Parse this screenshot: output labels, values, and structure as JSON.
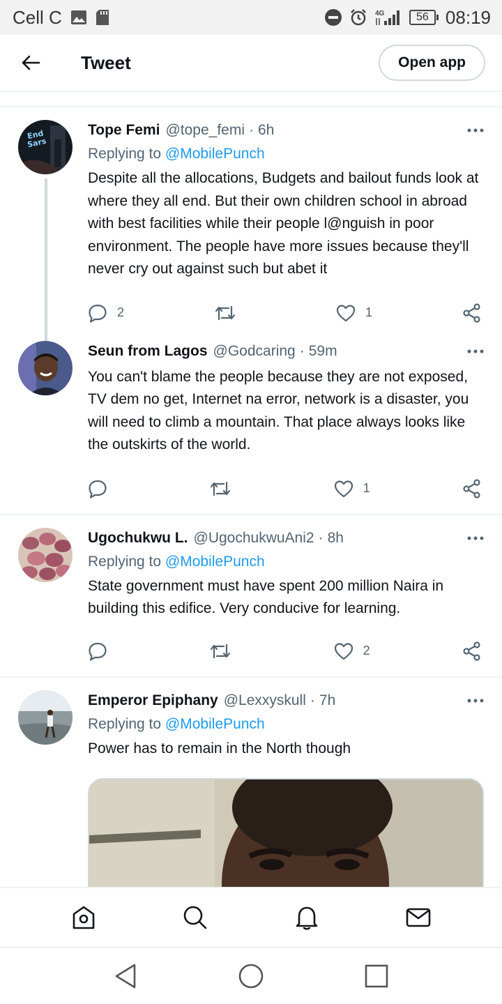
{
  "status_bar": {
    "carrier": "Cell C",
    "network": "4G",
    "battery": "56",
    "time": "08:19",
    "icons": [
      "image-icon",
      "sd-card-icon",
      "do-not-disturb-icon",
      "alarm-icon",
      "signal-icon",
      "battery-icon"
    ]
  },
  "header": {
    "title": "Tweet",
    "open_app_label": "Open app"
  },
  "tweets": [
    {
      "name": "Tope Femi",
      "handle": "@tope_femi",
      "separator": "·",
      "time": "6h",
      "replying_prefix": "Replying to",
      "replying_to": "@MobilePunch",
      "text": "Despite all the allocations, Budgets and bailout funds look at where they all end. But their own children school in abroad with best facilities while their people l@nguish in poor environment. The people have more issues because they'll never cry out against such but abet it",
      "replies": "2",
      "retweets": "",
      "likes": "1",
      "avatar_text": "End Sars"
    },
    {
      "name": "Seun from Lagos",
      "handle": "@Godcaring",
      "separator": "·",
      "time": "59m",
      "text": "You can't blame the people because they are not exposed, TV dem no get, Internet na error, network is a disaster, you will need to climb a mountain. That place always looks like the outskirts of the world.",
      "replies": "",
      "retweets": "",
      "likes": "1"
    },
    {
      "name": "Ugochukwu L.",
      "handle": "@UgochukwuAni2",
      "separator": "·",
      "time": "8h",
      "replying_prefix": "Replying to",
      "replying_to": "@MobilePunch",
      "text": "State government must have spent 200 million Naira in building this edifice. Very conducive for learning.",
      "replies": "",
      "retweets": "",
      "likes": "2"
    },
    {
      "name": "Emperor Epiphany",
      "handle": "@Lexxyskull",
      "separator": "·",
      "time": "7h",
      "replying_prefix": "Replying to",
      "replying_to": "@MobilePunch",
      "text": "Power has to remain in the North though"
    }
  ],
  "icons": {
    "reply": "reply-icon",
    "retweet": "retweet-icon",
    "like": "heart-icon",
    "share": "share-icon",
    "more": "more-icon"
  },
  "colors": {
    "link": "#1d9bf0",
    "secondary_text": "#536471",
    "divider": "#eff3f4"
  },
  "bottom_nav": [
    "home-icon",
    "search-icon",
    "notifications-icon",
    "messages-icon"
  ],
  "system_nav": [
    "back-triangle-icon",
    "home-circle-icon",
    "recents-square-icon"
  ]
}
